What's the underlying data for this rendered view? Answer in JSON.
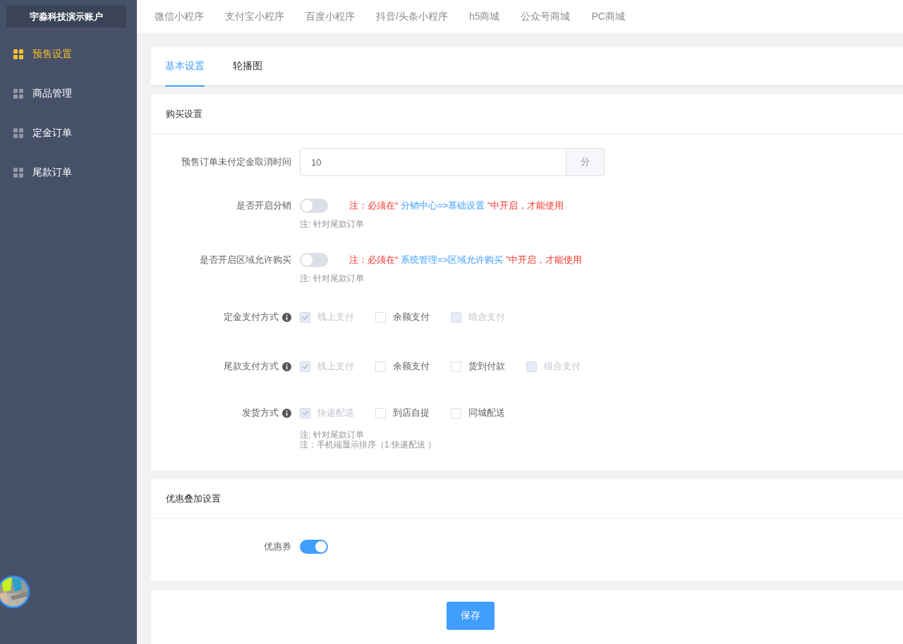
{
  "sidebar": {
    "account": "宇淼科技演示账户",
    "items": [
      {
        "label": "预售设置",
        "selected": true
      },
      {
        "label": "商品管理",
        "selected": false
      },
      {
        "label": "定金订单",
        "selected": false
      },
      {
        "label": "尾款订单",
        "selected": false
      }
    ]
  },
  "top_nav": [
    "微信小程序",
    "支付宝小程序",
    "百度小程序",
    "抖音/头条小程序",
    "h5商城",
    "公众号商城",
    "PC商城"
  ],
  "tabs": [
    {
      "label": "基本设置",
      "selected": true
    },
    {
      "label": "轮播图",
      "selected": false
    }
  ],
  "purchase": {
    "title": "购买设置",
    "cancel_time": {
      "label": "预售订单未付定金取消时间",
      "value": "10",
      "unit": "分"
    },
    "switches": [
      {
        "label": "是否开启分销",
        "on": false,
        "warn_before": "注：必须在“ ",
        "link": "分销中心=>基础设置",
        "warn_after": " ”中开启，才能使用",
        "hint": "注: 针对尾款订单"
      },
      {
        "label": "是否开启区域允许购买",
        "on": false,
        "warn_before": "注：必须在“ ",
        "link": "系统管理=>区域允许购买",
        "warn_after": " ”中开启，才能使用",
        "hint": "注: 针对尾款订单"
      }
    ],
    "groups": [
      {
        "label": "定金支付方式",
        "options": [
          {
            "label": "线上支付",
            "checked": true,
            "disabled": true
          },
          {
            "label": "余额支付",
            "checked": false,
            "disabled": false
          },
          {
            "label": "组合支付",
            "checked": false,
            "disabled": true
          }
        ]
      },
      {
        "label": "尾款支付方式",
        "options": [
          {
            "label": "线上支付",
            "checked": true,
            "disabled": true
          },
          {
            "label": "余额支付",
            "checked": false,
            "disabled": false
          },
          {
            "label": "货到付款",
            "checked": false,
            "disabled": false
          },
          {
            "label": "组合支付",
            "checked": false,
            "disabled": true
          }
        ]
      },
      {
        "label": "发货方式",
        "options": [
          {
            "label": "快递配送",
            "checked": true,
            "disabled": true
          },
          {
            "label": "到店自提",
            "checked": false,
            "disabled": false
          },
          {
            "label": "同城配送",
            "checked": false,
            "disabled": false
          }
        ],
        "hints": [
          "注: 针对尾款订单",
          "注：手机端显示排序（1.快递配送 ）"
        ]
      }
    ]
  },
  "discount": {
    "title": "优惠叠加设置",
    "switches": [
      {
        "label": "优惠券",
        "on": true
      }
    ]
  },
  "save_button": "保存"
}
